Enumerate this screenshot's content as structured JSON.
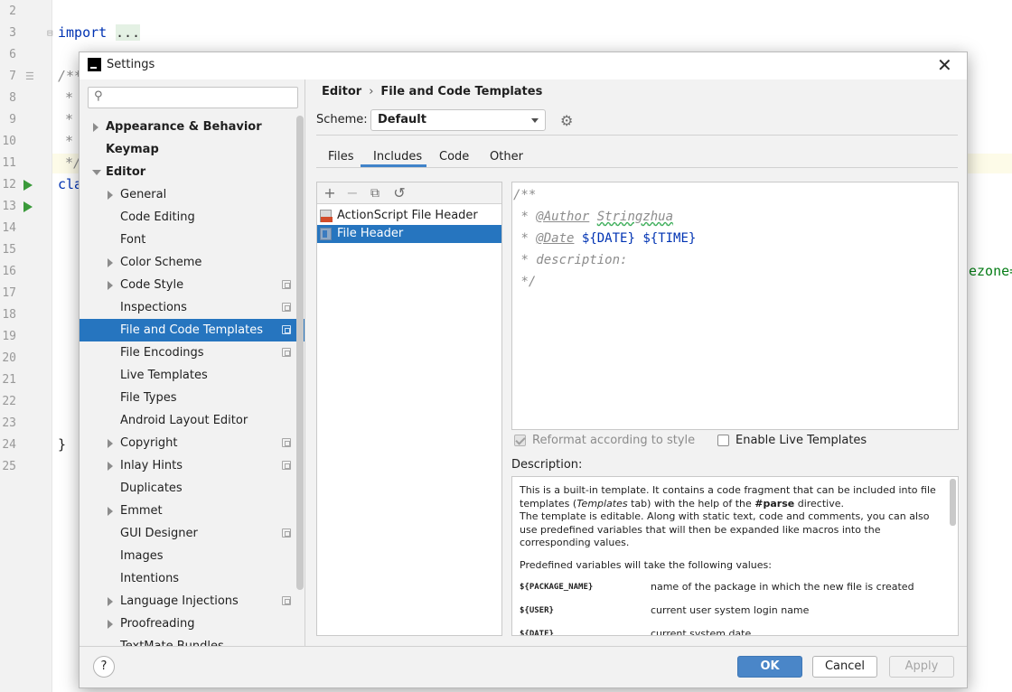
{
  "editor": {
    "line_numbers": [
      "2",
      "3",
      "6",
      "7",
      "8",
      "9",
      "10",
      "11",
      "12",
      "13",
      "14",
      "15",
      "16",
      "17",
      "18",
      "19",
      "20",
      "21",
      "22",
      "23",
      "24",
      "25"
    ],
    "import_kw": "import",
    "import_fold": "...",
    "comment_open": "/**",
    "star": "*",
    "comment_close": "*/",
    "class_kw_partial": "cla",
    "closing_brace": "}",
    "right_snippet": "ezone="
  },
  "dialog": {
    "title": "Settings",
    "close_glyph": "✕"
  },
  "search": {
    "placeholder": "",
    "value": "",
    "icon_glyph": "⚲"
  },
  "tree": {
    "items": [
      {
        "label": "Appearance & Behavior"
      },
      {
        "label": "Keymap"
      },
      {
        "label": "Editor"
      },
      {
        "label": "General"
      },
      {
        "label": "Code Editing"
      },
      {
        "label": "Font"
      },
      {
        "label": "Color Scheme"
      },
      {
        "label": "Code Style"
      },
      {
        "label": "Inspections"
      },
      {
        "label": "File and Code Templates"
      },
      {
        "label": "File Encodings"
      },
      {
        "label": "Live Templates"
      },
      {
        "label": "File Types"
      },
      {
        "label": "Android Layout Editor"
      },
      {
        "label": "Copyright"
      },
      {
        "label": "Inlay Hints"
      },
      {
        "label": "Duplicates"
      },
      {
        "label": "Emmet"
      },
      {
        "label": "GUI Designer"
      },
      {
        "label": "Images"
      },
      {
        "label": "Intentions"
      },
      {
        "label": "Language Injections"
      },
      {
        "label": "Proofreading"
      },
      {
        "label": "TextMate Bundles"
      }
    ]
  },
  "breadcrumb": {
    "parent": "Editor",
    "separator": "›",
    "current": "File and Code Templates"
  },
  "scheme": {
    "label": "Scheme:",
    "value": "Default"
  },
  "tabs": [
    {
      "label": "Files"
    },
    {
      "label": "Includes"
    },
    {
      "label": "Code"
    },
    {
      "label": "Other"
    }
  ],
  "toolbar": {
    "add": "+",
    "remove": "−",
    "copy": "⧉",
    "reset": "↺"
  },
  "templates": [
    {
      "label": "ActionScript File Header"
    },
    {
      "label": "File Header"
    }
  ],
  "code": {
    "line1": "/**",
    "line2_prefix": "* ",
    "line2_tag": "@Author",
    "line2_value": "Stringzhua",
    "line3_prefix": "* ",
    "line3_tag": "@Date",
    "line3_var1": "${DATE}",
    "line3_var2": "${TIME}",
    "line4": "* description:",
    "line5": "*/"
  },
  "options": {
    "reformat_label": "Reformat according to style",
    "live_templates_label": "Enable Live Templates"
  },
  "description": {
    "label": "Description:",
    "p1_a": "This is a built-in template. It contains a code fragment that can be included into file templates (",
    "p1_em": "Templates",
    "p1_b": " tab) with the help of the ",
    "p1_strong": "#parse",
    "p1_c": " directive.",
    "p2": "The template is editable. Along with static text, code and comments, you can also use predefined variables that will then be expanded like macros into the corresponding values.",
    "p3": "Predefined variables will take the following values:",
    "vars": [
      {
        "name": "${PACKAGE_NAME}",
        "desc": "name of the package in which the new file is created"
      },
      {
        "name": "${USER}",
        "desc": "current user system login name"
      },
      {
        "name": "${DATE}",
        "desc": "current system date"
      }
    ]
  },
  "buttons": {
    "help": "?",
    "ok": "OK",
    "cancel": "Cancel",
    "apply": "Apply"
  }
}
